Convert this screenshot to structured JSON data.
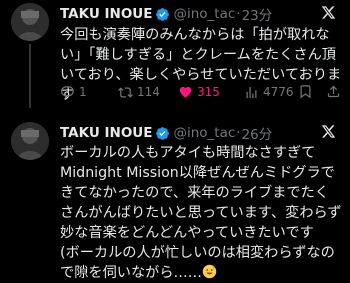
{
  "tweets": [
    {
      "name": "TAKU INOUE",
      "handle": "@ino_tac",
      "sep": "·",
      "time": "23分",
      "text": "今回も演奏陣のみんなからは「拍が取れない」「難しすぎる」とクレームをたくさん頂いており、楽しくやらせていただいております",
      "replies": "1",
      "retweets": "114",
      "likes": "315",
      "views": "4776"
    },
    {
      "name": "TAKU INOUE",
      "handle": "@ino_tac",
      "sep": "·",
      "time": "26分",
      "text": "ボーカルの人もアタイも時間なさすぎて\nMidnight Mission以降ぜんぜんミドグラできてなかったので、来年のライブまでたくさんがんばりたいと思っています、変わらず妙な音楽をどんどんやっていきたいです\n(ボーカルの人が忙しいのは相変わらずなので隙を伺いながら……",
      "text_end_emoji": "grinning-sweat-emoji"
    }
  ],
  "colors": {
    "background": "#000000",
    "text": "#e7e9ea",
    "muted": "#71767b",
    "verified": "#1d9bf0",
    "like": "#f91880"
  },
  "icons": [
    "verified-badge-icon",
    "x-logo-icon",
    "reply-icon",
    "retweet-icon",
    "heart-icon",
    "views-icon"
  ]
}
